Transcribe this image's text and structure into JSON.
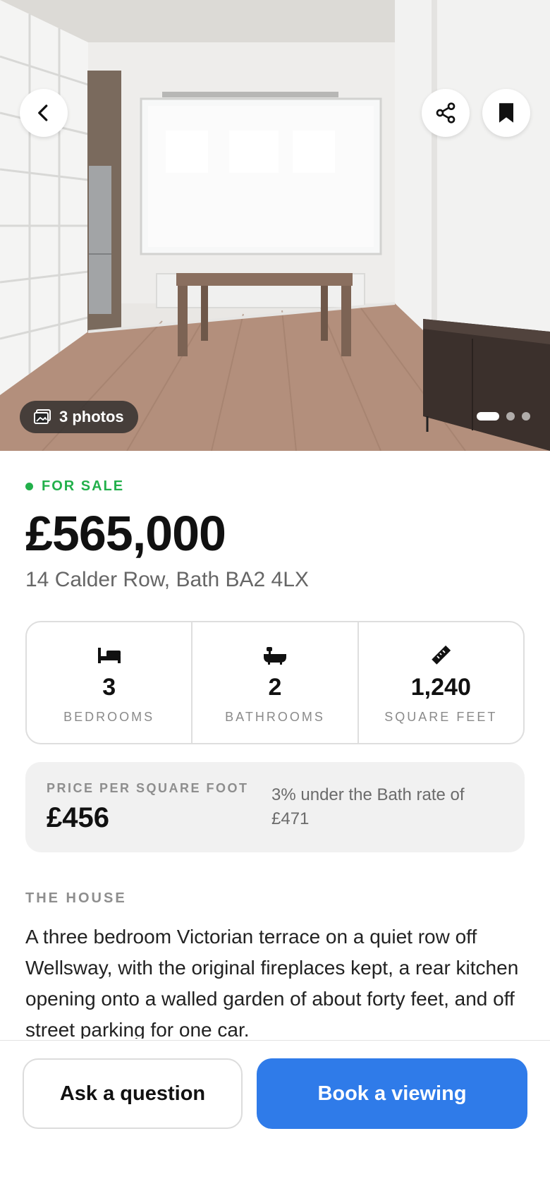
{
  "hero": {
    "photos_label": "3 photos",
    "photo_count": 3,
    "active_photo_index": 0,
    "icons": {
      "back": "chevron-left-icon",
      "share": "share-icon",
      "save": "bookmark-icon",
      "photos": "photos-icon"
    }
  },
  "listing": {
    "status": "FOR SALE",
    "status_color": "#22b04b",
    "price": "£565,000",
    "address": "14 Calder Row, Bath BA2 4LX"
  },
  "facts": [
    {
      "icon": "bed-icon",
      "value": "3",
      "label": "BEDROOMS"
    },
    {
      "icon": "bath-icon",
      "value": "2",
      "label": "BATHROOMS"
    },
    {
      "icon": "ruler-icon",
      "value": "1,240",
      "label": "SQUARE FEET"
    }
  ],
  "price_per_sqft": {
    "label": "PRICE PER SQUARE FOOT",
    "value": "£456",
    "note": "3% under the Bath rate of £471"
  },
  "house": {
    "heading": "THE HOUSE",
    "description": "A three bedroom Victorian terrace on a quiet row off Wellsway, with the original fireplaces kept, a rear kitchen opening onto a walled garden of about forty feet, and off street parking for one car."
  },
  "actions": {
    "ask_label": "Ask a question",
    "book_label": "Book a viewing",
    "primary_color": "#2f7be9"
  }
}
